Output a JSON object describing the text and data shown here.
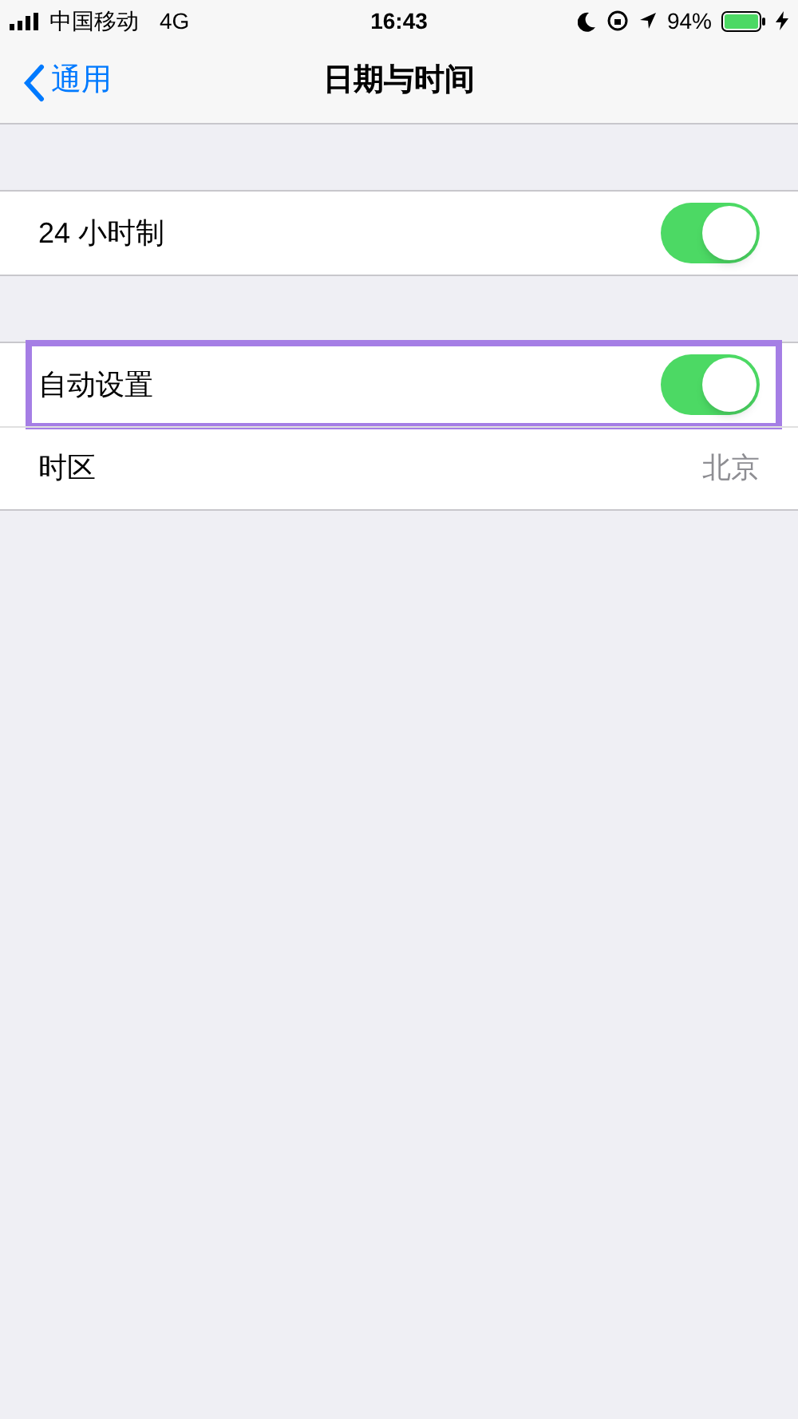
{
  "status_bar": {
    "carrier": "中国移动",
    "network": "4G",
    "time": "16:43",
    "battery": "94%"
  },
  "nav": {
    "back": "通用",
    "title": "日期与时间"
  },
  "sections": [
    {
      "rows": [
        {
          "kind": "toggle",
          "label": "24 小时制",
          "on": true,
          "highlighted": false
        }
      ]
    },
    {
      "rows": [
        {
          "kind": "toggle",
          "label": "自动设置",
          "on": true,
          "highlighted": true
        },
        {
          "kind": "value",
          "label": "时区",
          "value": "北京",
          "highlighted": false
        }
      ]
    }
  ]
}
